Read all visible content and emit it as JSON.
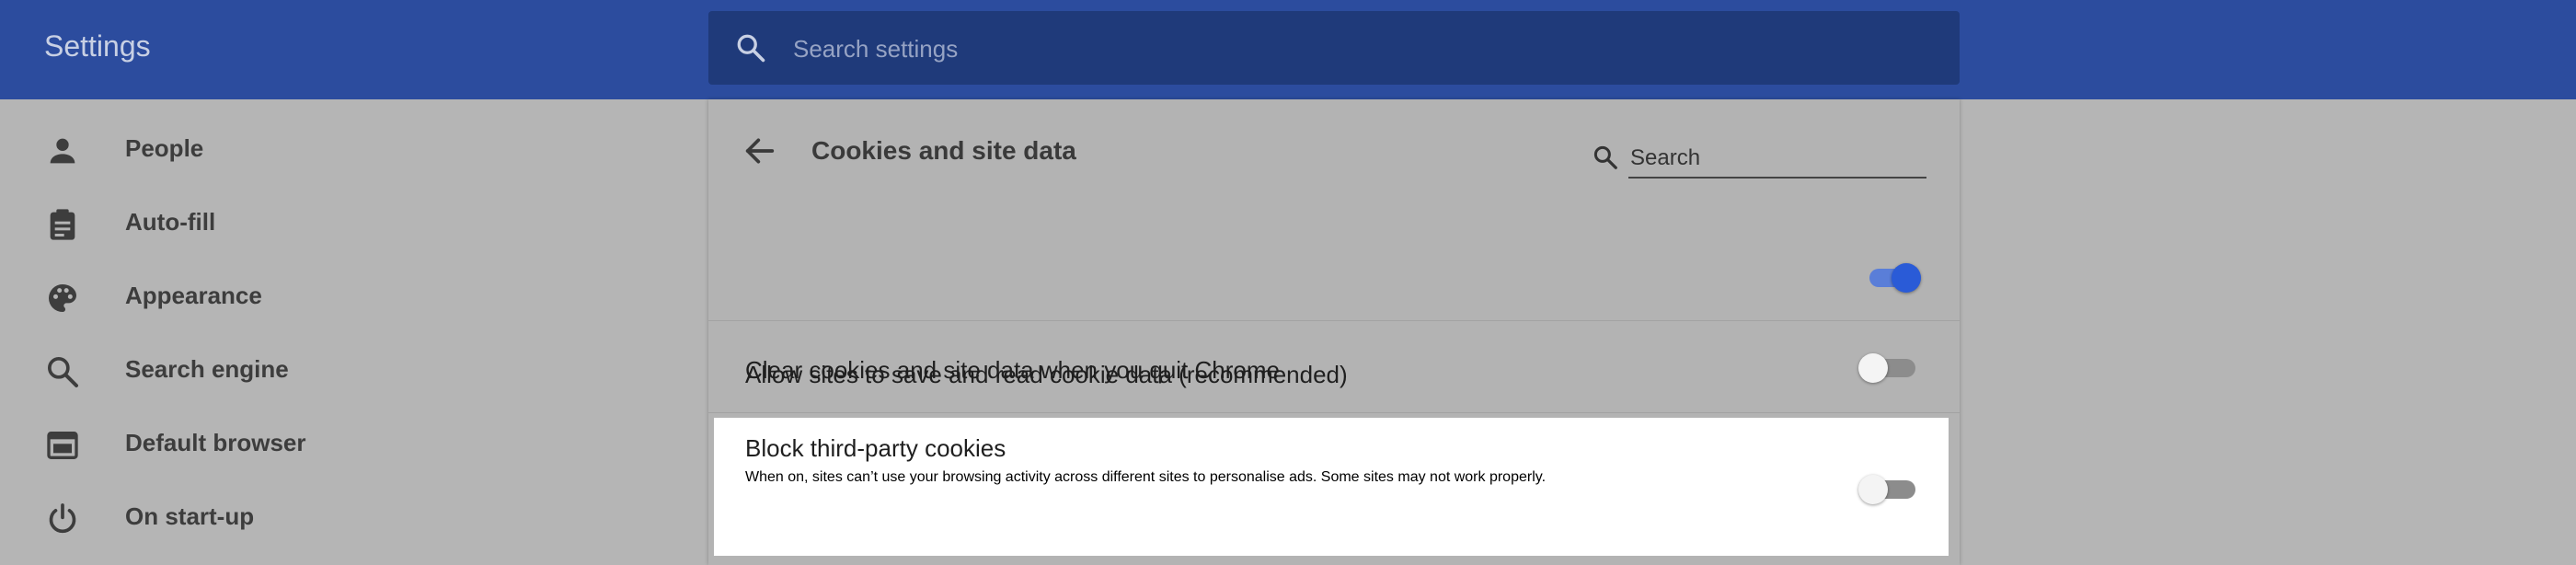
{
  "header": {
    "title": "Settings",
    "search_placeholder": "Search settings"
  },
  "sidebar": {
    "items": [
      {
        "label": "People",
        "icon": "person-icon"
      },
      {
        "label": "Auto-fill",
        "icon": "clipboard-icon"
      },
      {
        "label": "Appearance",
        "icon": "palette-icon"
      },
      {
        "label": "Search engine",
        "icon": "search-icon"
      },
      {
        "label": "Default browser",
        "icon": "browser-window-icon"
      },
      {
        "label": "On start-up",
        "icon": "power-icon"
      }
    ]
  },
  "page": {
    "title": "Cookies and site data",
    "search_placeholder": "Search",
    "rows": [
      {
        "label": "Allow sites to save and read cookie data (recommended)",
        "enabled": true
      },
      {
        "label": "Clear cookies and site data when you quit Chrome",
        "enabled": false
      },
      {
        "label": "Block third-party cookies",
        "description": "When on, sites can’t use your browsing activity across different sites to personalise ads. Some sites may not work properly.",
        "enabled": false
      }
    ]
  },
  "colors": {
    "header_bg": "#2c4c9e",
    "search_bg": "#1f3a7a",
    "accent": "#2a5bd7",
    "toggle_on_track": "#5a7ed8",
    "toggle_off_track": "#8c8c8c",
    "toggle_off_knob": "#f4f4f4"
  }
}
